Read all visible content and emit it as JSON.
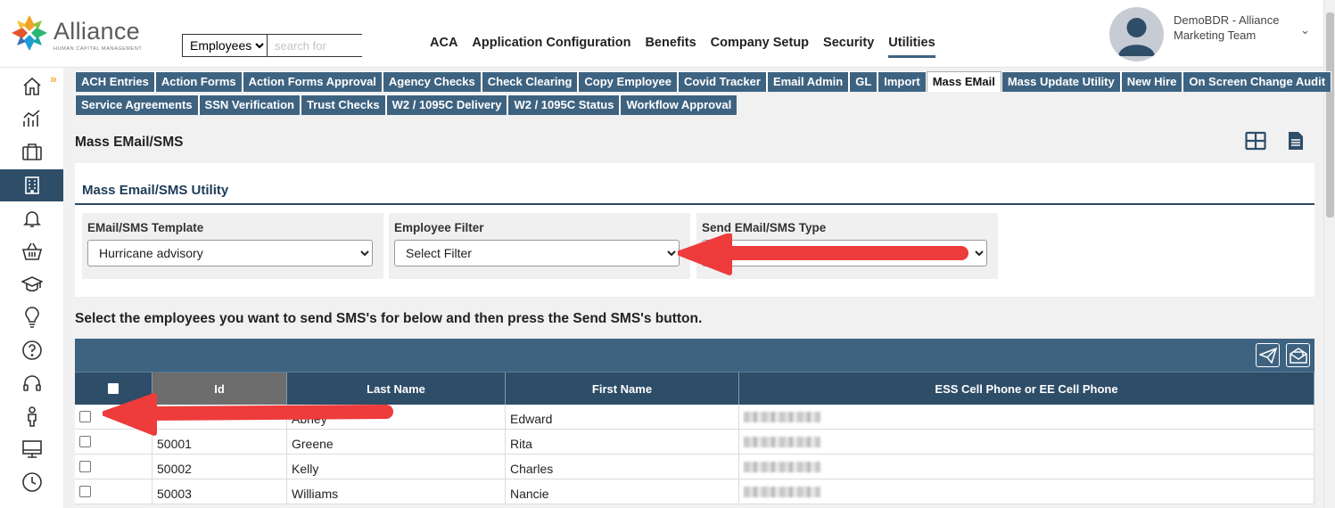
{
  "brand": {
    "name": "Alliance",
    "tagline": "HUMAN CAPITAL MANAGEMENT"
  },
  "search": {
    "selected": "Employees",
    "placeholder": "search for"
  },
  "mainnav": [
    {
      "label": "ACA",
      "active": false
    },
    {
      "label": "Application Configuration",
      "active": false
    },
    {
      "label": "Benefits",
      "active": false
    },
    {
      "label": "Company Setup",
      "active": false
    },
    {
      "label": "Security",
      "active": false
    },
    {
      "label": "Utilities",
      "active": true
    }
  ],
  "user": {
    "name": "DemoBDR - Alliance Marketing Team",
    "caret": "⌄"
  },
  "sidebar": [
    {
      "icon": "home-icon"
    },
    {
      "icon": "analytics-icon"
    },
    {
      "icon": "briefcase-icon"
    },
    {
      "icon": "building-icon",
      "active": true
    },
    {
      "icon": "bell-icon"
    },
    {
      "icon": "basket-icon"
    },
    {
      "icon": "graduation-cap-icon"
    },
    {
      "icon": "lightbulb-icon"
    },
    {
      "icon": "help-icon"
    },
    {
      "icon": "headset-icon"
    },
    {
      "icon": "person-icon"
    },
    {
      "icon": "monitor-icon"
    },
    {
      "icon": "clock-icon"
    }
  ],
  "expander": "»",
  "tabs_row1": [
    "ACH Entries",
    "Action Forms",
    "Action Forms Approval",
    "Agency Checks",
    "Check Clearing",
    "Copy Employee",
    "Covid Tracker",
    "Email Admin",
    "GL",
    "Import",
    "Mass EMail",
    "Mass Update Utility",
    "New Hire",
    "On Screen Change Audit"
  ],
  "tabs_row2": [
    "Service Agreements",
    "SSN Verification",
    "Trust Checks",
    "W2 / 1095C Delivery",
    "W2 / 1095C Status",
    "Workflow Approval"
  ],
  "active_tab": "Mass EMail",
  "page_title": "Mass EMail/SMS",
  "panel": {
    "title": "Mass Email/SMS Utility",
    "template_label": "EMail/SMS Template",
    "template_value": "Hurricane advisory",
    "filter_label": "Employee Filter",
    "filter_value": "Select Filter",
    "type_label": "Send EMail/SMS Type",
    "type_value": ""
  },
  "instruction": "Select the employees you want to send SMS's for below and then press the Send SMS's button.",
  "grid": {
    "columns": [
      "Id",
      "Last Name",
      "First Name",
      "ESS Cell Phone or EE Cell Phone"
    ],
    "rows": [
      {
        "id": "",
        "last": "Abney",
        "first": "Edward"
      },
      {
        "id": "50001",
        "last": "Greene",
        "first": "Rita"
      },
      {
        "id": "50002",
        "last": "Kelly",
        "first": "Charles"
      },
      {
        "id": "50003",
        "last": "Williams",
        "first": "Nancie"
      }
    ]
  },
  "colors": {
    "nav": "#3e6381",
    "header": "#2e4d68",
    "annotation_arrow": "#ee3b3b"
  }
}
